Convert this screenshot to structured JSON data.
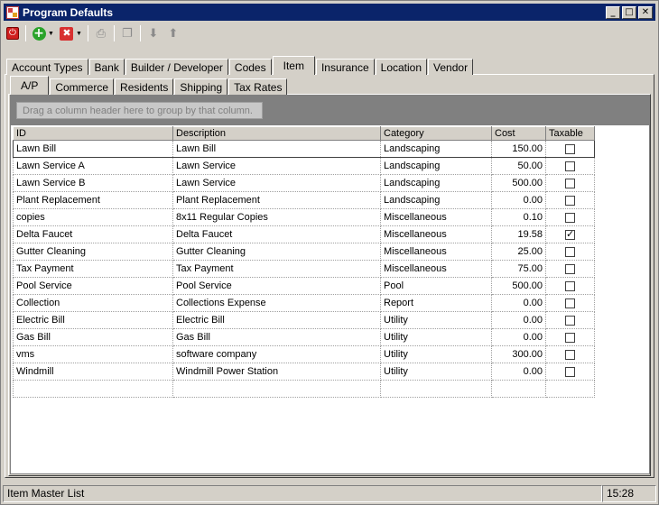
{
  "window": {
    "title": "Program Defaults"
  },
  "toolbar": {
    "icons": [
      "power-icon",
      "add-icon",
      "delete-icon",
      "print-icon",
      "copy-icon",
      "arrow-down-icon",
      "arrow-up-icon"
    ]
  },
  "tabs_main": [
    "Account Types",
    "Bank",
    "Builder / Developer",
    "Codes",
    "Item",
    "Insurance",
    "Location",
    "Vendor"
  ],
  "tabs_main_active": "Item",
  "tabs_sub": [
    "A/P",
    "Commerce",
    "Residents",
    "Shipping",
    "Tax Rates"
  ],
  "tabs_sub_active": "A/P",
  "grid": {
    "group_hint": "Drag a column header here to group by that column.",
    "columns": [
      "ID",
      "Description",
      "Category",
      "Cost",
      "Taxable"
    ],
    "rows": [
      {
        "id": "Lawn Bill",
        "description": "Lawn Bill",
        "category": "Landscaping",
        "cost": "150.00",
        "taxable": false
      },
      {
        "id": "Lawn Service A",
        "description": "Lawn Service",
        "category": "Landscaping",
        "cost": "50.00",
        "taxable": false
      },
      {
        "id": "Lawn Service B",
        "description": "Lawn Service",
        "category": "Landscaping",
        "cost": "500.00",
        "taxable": false
      },
      {
        "id": "Plant Replacement",
        "description": "Plant Replacement",
        "category": "Landscaping",
        "cost": "0.00",
        "taxable": false
      },
      {
        "id": "copies",
        "description": "8x11 Regular Copies",
        "category": "Miscellaneous",
        "cost": "0.10",
        "taxable": false
      },
      {
        "id": "Delta Faucet",
        "description": "Delta Faucet",
        "category": "Miscellaneous",
        "cost": "19.58",
        "taxable": true
      },
      {
        "id": "Gutter Cleaning",
        "description": "Gutter Cleaning",
        "category": "Miscellaneous",
        "cost": "25.00",
        "taxable": false
      },
      {
        "id": "Tax Payment",
        "description": "Tax Payment",
        "category": "Miscellaneous",
        "cost": "75.00",
        "taxable": false
      },
      {
        "id": "Pool Service",
        "description": "Pool Service",
        "category": "Pool",
        "cost": "500.00",
        "taxable": false
      },
      {
        "id": "Collection",
        "description": "Collections Expense",
        "category": "Report",
        "cost": "0.00",
        "taxable": false
      },
      {
        "id": "Electric Bill",
        "description": "Electric Bill",
        "category": "Utility",
        "cost": "0.00",
        "taxable": false
      },
      {
        "id": "Gas Bill",
        "description": "Gas Bill",
        "category": "Utility",
        "cost": "0.00",
        "taxable": false
      },
      {
        "id": "vms",
        "description": "software company",
        "category": "Utility",
        "cost": "300.00",
        "taxable": false
      },
      {
        "id": "Windmill",
        "description": "Windmill Power Station",
        "category": "Utility",
        "cost": "0.00",
        "taxable": false
      }
    ]
  },
  "status": {
    "left": "Item Master List",
    "time": "15:28"
  }
}
